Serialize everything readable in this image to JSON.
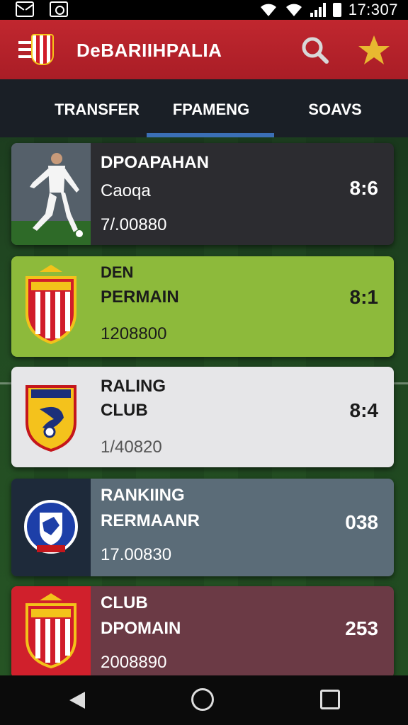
{
  "status_bar": {
    "time": "17:307",
    "icons": [
      "mail-icon",
      "image-icon",
      "wifi-icon",
      "wifi-icon",
      "signal-icon",
      "battery-icon"
    ]
  },
  "header": {
    "title": "DeBARIIHPALIA",
    "icons": [
      "menu-icon",
      "club-crest-icon",
      "search-icon",
      "star-icon"
    ],
    "accent_color": "#c1272f"
  },
  "tabs": [
    {
      "label": "TRANSFER",
      "active": false
    },
    {
      "label": "FPAMENG",
      "active": true
    },
    {
      "label": "SOAVS",
      "active": false
    }
  ],
  "tab_indicator_color": "#3b6fb5",
  "cards": [
    {
      "line1": "DPOAPAHAN",
      "line2": "Caoqa",
      "line3": "7/.00880",
      "score": "8:6",
      "thumb": "player-photo",
      "bg": "#2c2c30"
    },
    {
      "line1": "DEN",
      "line2": "PERMAIN",
      "line3": "1208800",
      "score": "8:1",
      "thumb": "red-white-crest-icon",
      "bg": "#8dba3b"
    },
    {
      "line1": "RALING",
      "line2": "CLUB",
      "line3": "1/40820",
      "score": "8:4",
      "thumb": "yellow-blue-crest-icon",
      "bg": "#e6e6e8"
    },
    {
      "line1": "RANKIING",
      "line2": "RERMAANR",
      "line3": "17.00830",
      "score": "038",
      "thumb": "blue-round-crest-icon",
      "bg": "#5b6c78"
    },
    {
      "line1": "CLUB",
      "line2": "DPOMAIN",
      "line3": "2008890",
      "score": "253",
      "thumb": "red-white-crest-icon",
      "bg": "#6b3a45"
    }
  ],
  "nav": {
    "icons": [
      "back-icon",
      "home-icon",
      "recents-icon"
    ]
  }
}
